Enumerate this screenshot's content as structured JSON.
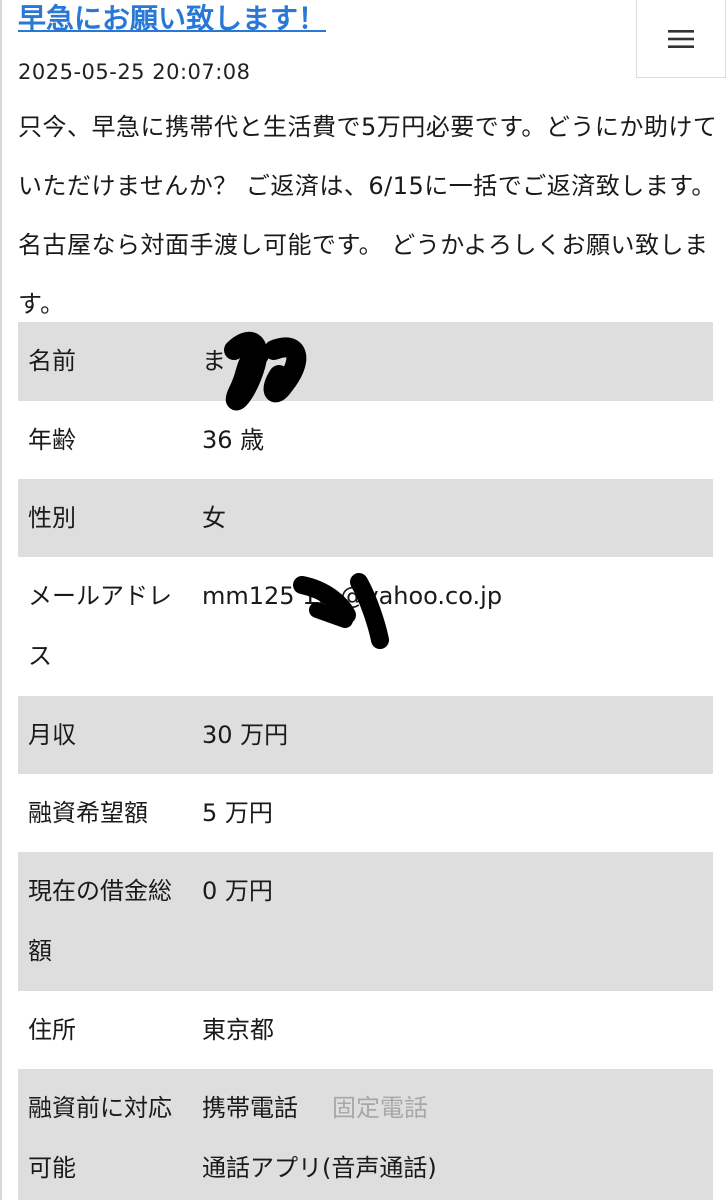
{
  "post": {
    "title": "早急にお願い致します！",
    "date": "2025-05-25 20:07:08",
    "message": "只今、早急に携帯代と生活費で5万円必要です。どうにか助けていただけませんか？ ご返済は、6/15に一括でご返済致します。 名古屋なら対面手渡し可能です。 どうかよろしくお願い致します。"
  },
  "menu": {
    "icon": "hamburger-menu-icon"
  },
  "profile": {
    "name_label": "名前",
    "name_value": "ま",
    "age_label": "年齢",
    "age_value": "36 歳",
    "gender_label": "性別",
    "gender_value": "女",
    "email_label": "メールアドレス",
    "email_value": "mm125  18  @yahoo.co.jp",
    "income_label": "月収",
    "income_value": "30 万円",
    "loan_label": "融資希望額",
    "loan_value": "5 万円",
    "debt_label": "現在の借金総額",
    "debt_value": "0 万円",
    "address_label": "住所",
    "address_value": "東京都",
    "contact_label": "融資前に対応可能",
    "contact_mobile": "携帯電話",
    "contact_landline": "固定電話",
    "contact_app": "通話アプリ(音声通話)"
  },
  "colors": {
    "title_link": "#2a78d6",
    "row_shade": "#dedede",
    "muted_text": "#a8a8a8"
  }
}
